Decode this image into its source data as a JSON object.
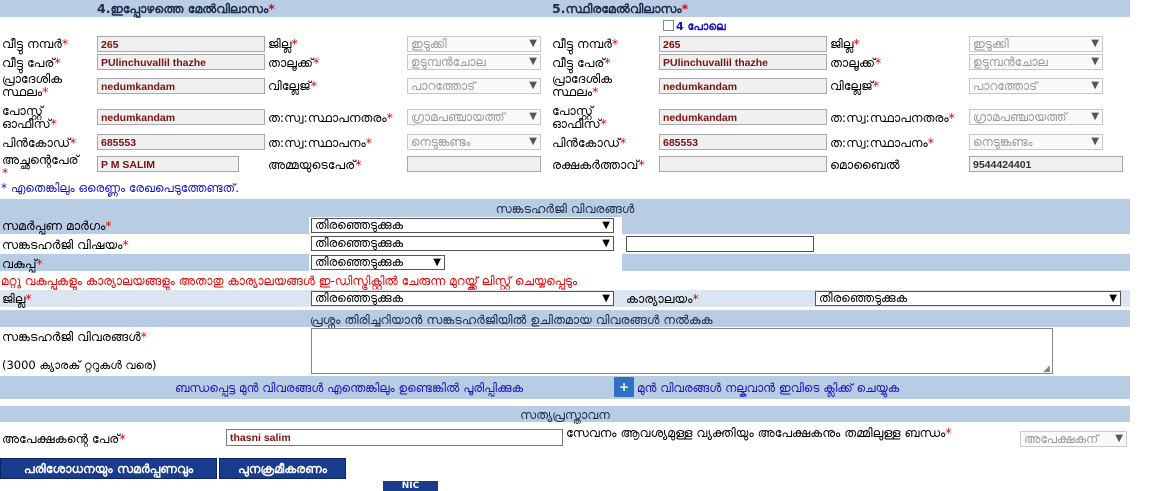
{
  "present_addr": {
    "title": "4.ഇപ്പോഴത്തെ മേൽവിലാസം",
    "star": "*"
  },
  "perm_addr": {
    "title": "5.സ്ഥിരമേൽവിലാസം",
    "star": "*",
    "same_as_label": "4 പോലെ"
  },
  "labels": {
    "house_no": "വീട്ടു നമ്പർ",
    "house_name": "വീട്ടു പേര്",
    "place": "പ്രാദേശിക സ്ഥലം",
    "post": "പോസ്റ്റ് ഓഫീസ്",
    "pin": "പിൻകോഡ്",
    "district": "ജില്ല",
    "taluk": "താലൂക്ക്",
    "village": "വില്ലേജ്",
    "lb_type": "ത:സ്വ:സ്ഥാപനതരം",
    "lb": "ത:സ്വ:സ്ഥാപനം",
    "father": "അച്ഛന്റെപേര്",
    "mother": "അമ്മയുടെപേര്",
    "guardian": "രക്ഷകർത്താവ്",
    "mobile": "മൊബൈൽ",
    "star": "*"
  },
  "present": {
    "house_no": "265",
    "house_name": "PUlinchuvallil thazhe",
    "place": "nedumkandam",
    "post": "nedumkandam",
    "pin": "685553",
    "district": "ഇടുക്കി",
    "taluk": "ഉടുമ്പൻചോല",
    "village": "പാറത്തോട്",
    "lb_type": "ഗ്രാമപഞ്ചായത്ത്",
    "lb": "നെടുങ്കണ്ടം",
    "father": "P M SALIM",
    "mother": ""
  },
  "permanent": {
    "house_no": "265",
    "house_name": "PUlinchuvallil thazhe",
    "place": "nedumkandam",
    "post": "nedumkandam",
    "pin": "685553",
    "district": "ഇടുക്കി",
    "taluk": "ഉടുമ്പൻചോല",
    "village": "പാറത്തോട്",
    "lb_type": "ഗ്രാമപഞ്ചായത്ത്",
    "lb": "നെടുങ്കണ്ടം",
    "guardian": "",
    "mobile": "9544424401"
  },
  "note_one_required": "* എതെങ്കിലും ഒരെണ്ണം രേഖപെടുത്തേണ്ടത്.",
  "grievance": {
    "section_title": "സങ്കടഹർജി വിവരങ്ങൾ",
    "mode_label": "സമർപ്പണ മാർഗം",
    "subject_label": "സങ്കടഹർജി വിഷയം",
    "dept_label": "വകുപ്പ്",
    "select_placeholder": "തിരഞ്ഞെടുക്കുക",
    "dept_note": "മറ്റു വകുപ്പുകളും കാര്യാലയങ്ങളും അതാതു കാര്യാലയങ്ങൾ ഇ-ഡിസ്ട്രിക്റ്റിൽ ചേരുന്ന മുറയ്ക്ക് ലിസ്റ്റ് ചെയ്യപ്പെടും",
    "district_label": "ജില്ല",
    "office_label": "കാര്യാലയം",
    "subject_other": ""
  },
  "details": {
    "band_text": "പ്രശ്നം തിരിച്ചറിയാൻ സങ്കടഹർജിയിൽ ഉചിതമായ വിവരങ്ങൾ നൽകുക",
    "label": "സങ്കടഹർജി വിവരങ്ങൾ",
    "limit": "(3000 ക്യാരക് റ്ററുകൾ വരെ)",
    "value": ""
  },
  "prior": {
    "text_left": "ബന്ധപ്പെട്ട മുൻ വിവരങ്ങൾ എന്തെങ്കിലും ഉണ്ടെങ്കിൽ പൂരിപ്പിക്കുക",
    "plus": "+",
    "text_right": "മുൻ വിവരങ്ങൾ നല്കുവാൻ ഇവിടെ ക്ലിക്ക് ചെയ്യുക"
  },
  "declaration": {
    "title": "സത്യപ്രസ്താവന",
    "applicant_label": "അപേക്ഷകന്റെ പേര്",
    "applicant_value": "thasni salim",
    "relation_label": "സേവനം ആവശ്യമുള്ള വ്യക്തിയും അപേക്ഷകനും തമ്മിലുള്ള ബന്ധം",
    "relation_value": "അപേക്ഷകന്"
  },
  "buttons": {
    "submit": "പരിശോധനയും സമർപ്പണവും",
    "reset": "പുനക്രമീകരണം"
  },
  "footer": {
    "logo_text": "NIC"
  },
  "colors": {
    "band": "#b8cce4",
    "band_light": "#dbe5f1",
    "required": "#e00000",
    "button": "#1a3c8c",
    "note": "#1515c8"
  }
}
